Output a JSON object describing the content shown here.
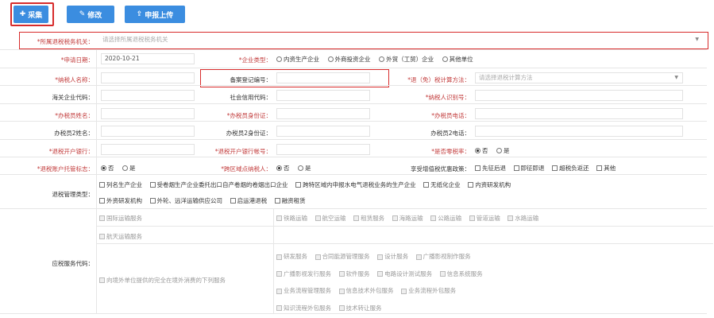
{
  "toolbar": {
    "collect_label": "采集",
    "edit_label": "修改",
    "upload_label": "申报上传"
  },
  "fields": {
    "tax_office_label": "*所属退税税务机关：",
    "tax_office_placeholder": "请选择所属退税税务机关",
    "apply_date_label": "*申请日期：",
    "apply_date_value": "2020-10-21",
    "company_type_label": "*企业类型：",
    "company_types": [
      "内资生产企业",
      "外商投资企业",
      "外贸（工贸）企业",
      "其他单位"
    ],
    "taxpayer_name_label": "*纳税人名称：",
    "record_no_label": "备案登记编号：",
    "refund_method_label": "*退（免）税计算方法：",
    "refund_method_placeholder": "请选择退税计算方法",
    "customs_code_label": "海关企业代码：",
    "credit_code_label": "社会信用代码：",
    "taxpayer_id_label": "*纳税人识别号：",
    "handler_name_label": "*办税员姓名：",
    "handler_id_label": "*办税员身份证：",
    "handler_phone_label": "*办税员电话：",
    "handler2_name_label": "办税员2姓名：",
    "handler2_id_label": "办税员2身份证：",
    "handler2_phone_label": "办税员2电话：",
    "bank_label": "*退税开户银行：",
    "bank_account_label": "*退税开户银行帐号：",
    "zero_rate_label": "*是否零税率：",
    "zero_rate_options": [
      "否",
      "是"
    ],
    "trust_label": "*退税账户托管标志：",
    "trust_options": [
      "否",
      "是"
    ],
    "cross_region_label": "*跨区域点纳税人：",
    "cross_region_options": [
      "否",
      "是"
    ],
    "vat_policy_label": "享受增值税优惠政策：",
    "vat_policies": [
      "先征后退",
      "即征即退",
      "超税负返还",
      "其他"
    ],
    "mgmt_type_label": "退税管理类型：",
    "mgmt_types_row1": [
      "列名生产企业",
      "受卷烟生产企业委托出口自产卷烟的卷烟出口企业",
      "跨特区域内申报水电气退税业务的生产企业",
      "无纸化企业",
      "内资研发机构"
    ],
    "mgmt_types_row2": [
      "外资研发机构",
      "外轮、远洋运输供应公司",
      "启运港退税",
      "融资租赁"
    ],
    "service_code_label": "应税服务代码：",
    "services_a": [
      "国际运输服务"
    ],
    "services_b": [
      "铁路运输",
      "航空运输",
      "租赁服务",
      "海路运输",
      "公路运输",
      "管道运输",
      "水路运输"
    ],
    "services_c": [
      "航天运输服务"
    ],
    "services_d1": [
      "研发服务",
      "合同能源管理服务",
      "设计服务",
      "广播影视制作服务"
    ],
    "services_d2": [
      "广播影视发行服务",
      "软件服务",
      "电路设计测试服务",
      "信息系统服务"
    ],
    "services_d3": [
      "业务流程管理服务",
      "信息技术外包服务",
      "业务流程外包服务"
    ],
    "services_d4": [
      "知识流程外包服务",
      "技术转让服务"
    ],
    "services_e": "向境外单位提供的完全在境外消费的下列服务"
  }
}
